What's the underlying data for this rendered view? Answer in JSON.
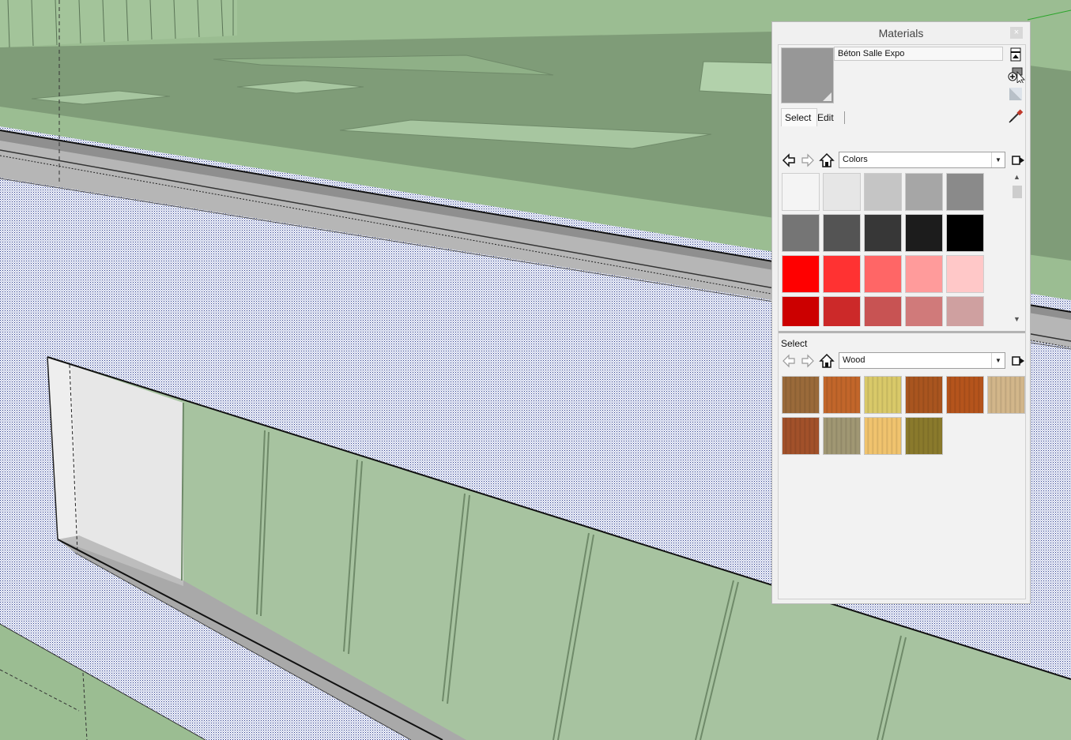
{
  "panel": {
    "title": "Materials",
    "close_label": "×",
    "material_name": "Béton Salle Expo",
    "current_color": "#979797",
    "tabs": [
      {
        "label": "Select",
        "active": true
      },
      {
        "label": "Edit",
        "active": false
      }
    ]
  },
  "top_browser": {
    "library": "Colors",
    "swatches": [
      "#f4f4f4",
      "#e6e6e6",
      "#c5c5c5",
      "#a6a6a6",
      "#8a8a8a",
      "#757575",
      "#545454",
      "#373737",
      "#1c1c1c",
      "#000000",
      "#ff0000",
      "#ff3232",
      "#ff6666",
      "#ff9b9b",
      "#ffc8c8",
      "#cc0000",
      "#cc2929",
      "#c85353",
      "#d07a7a",
      "#cfa0a0"
    ]
  },
  "bottom_browser": {
    "label": "Select",
    "library": "Wood",
    "swatches": [
      {
        "name": "wood-1",
        "color": "#9a6a3a"
      },
      {
        "name": "wood-2",
        "color": "#c2662a"
      },
      {
        "name": "wood-3",
        "color": "#d9c969"
      },
      {
        "name": "wood-4",
        "color": "#a9551f"
      },
      {
        "name": "wood-5",
        "color": "#b5541c"
      },
      {
        "name": "wood-6",
        "color": "#d2b68a"
      },
      {
        "name": "wood-7",
        "color": "#a2512a"
      },
      {
        "name": "wood-8",
        "color": "#a09773"
      },
      {
        "name": "wood-9",
        "color": "#f0c36e"
      },
      {
        "name": "wood-10",
        "color": "#8a7a2c"
      }
    ]
  },
  "icons": {
    "back": "back-arrow-icon",
    "forward": "forward-arrow-icon",
    "home": "home-icon",
    "details": "details-arrow-icon",
    "eyedropper": "eyedropper-icon",
    "create": "create-material-icon",
    "toggle": "display-secondary-pane-icon",
    "default": "default-material-icon"
  }
}
